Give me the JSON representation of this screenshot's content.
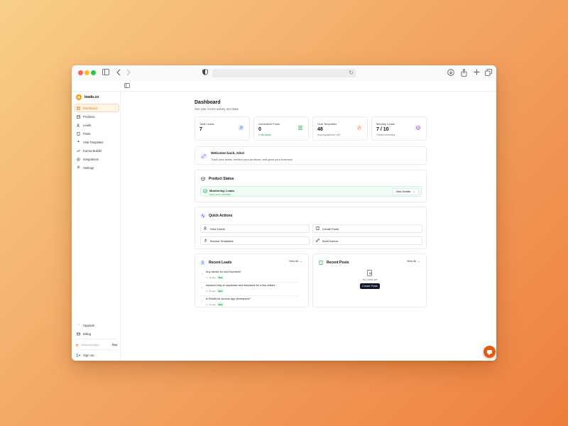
{
  "colors": {
    "accent": "#ea7a1a",
    "success": "#16a34a",
    "dark_button": "#111827",
    "chat_fab": "#ea580c"
  },
  "browser": {
    "icons": [
      "sidebar-toggle-icon",
      "back-icon",
      "forward-icon",
      "shield-icon",
      "reload-icon",
      "download-icon",
      "share-icon",
      "new-tab-icon",
      "tabs-overview-icon"
    ]
  },
  "sidebar": {
    "brand": "leado.co",
    "items": [
      {
        "label": "Dashboard",
        "icon": "grid-icon",
        "active": true
      },
      {
        "label": "Products",
        "icon": "box-icon"
      },
      {
        "label": "Leads",
        "icon": "users-icon"
      },
      {
        "label": "Posts",
        "icon": "document-icon"
      },
      {
        "label": "Viral Templates",
        "icon": "sparkle-icon"
      },
      {
        "label": "Karma Builder",
        "icon": "trend-icon"
      },
      {
        "label": "Integrations",
        "icon": "plug-icon"
      },
      {
        "label": "Settings",
        "icon": "gear-icon"
      }
    ],
    "bottom": [
      {
        "label": "Upgrade",
        "icon": "star-icon"
      },
      {
        "label": "Billing",
        "icon": "card-icon"
      }
    ],
    "user": {
      "initial": "A",
      "email": "hiddenuser@gm...",
      "plan": "Free"
    },
    "signout": "Sign out"
  },
  "page": {
    "title": "Dashboard",
    "subtitle": "See your recent activity and stats"
  },
  "stats": [
    {
      "label": "Total Leads",
      "value": "7",
      "sub": "",
      "icon": "users-icon",
      "icon_color": "#3b82f6",
      "icon_bg": "#eff6ff"
    },
    {
      "label": "Generated Posts",
      "value": "0",
      "sub": "0 new posts",
      "sub_color": "#16a34a",
      "icon": "document-icon",
      "icon_color": "#16a34a",
      "icon_bg": "#f0fdf4"
    },
    {
      "label": "Viral Templates",
      "value": "48",
      "sub": "Avg engagement: 443",
      "sub_color": "#777777",
      "icon": "flame-icon",
      "icon_color": "#ea580c",
      "icon_bg": "#fff7ed"
    },
    {
      "label": "Monthly Leads",
      "value": "7 / 10",
      "sub": "3 leads remaining",
      "sub_color": "#777777",
      "icon": "check-circle-icon",
      "icon_color": "#9333ea",
      "icon_bg": "#faf5ff"
    }
  ],
  "welcome": {
    "title": "Welcome back, Alex!",
    "subtitle": "Track your leads, monitor your products, and grow your business."
  },
  "product_status": {
    "title": "Product Status",
    "item_title": "Monitoring: Leado",
    "item_sub": "Active since 11/2/2025",
    "button": "View Details"
  },
  "quick_actions": {
    "title": "Quick Actions",
    "items": [
      {
        "label": "View Leads",
        "icon": "users-icon"
      },
      {
        "label": "Create Posts",
        "icon": "document-icon"
      },
      {
        "label": "Browse Templates",
        "icon": "flame-icon"
      },
      {
        "label": "Build Karma",
        "icon": "link-icon"
      }
    ]
  },
  "recent_leads": {
    "title": "Recent Leads",
    "view_all": "View All",
    "items": [
      {
        "title": "Any advice for solo founders?",
        "time": "2h ago",
        "badge": "New"
      },
      {
        "title": "replaced clay w/ supabase and deepseek for a few dollars",
        "time": "3h ago",
        "badge": "New"
      },
      {
        "title": "Is Reddit for serious app developers?",
        "time": "4h ago",
        "badge": "New"
      }
    ]
  },
  "recent_posts": {
    "title": "Recent Posts",
    "view_all": "View All",
    "empty": "No posts yet",
    "button": "Create Posts"
  }
}
